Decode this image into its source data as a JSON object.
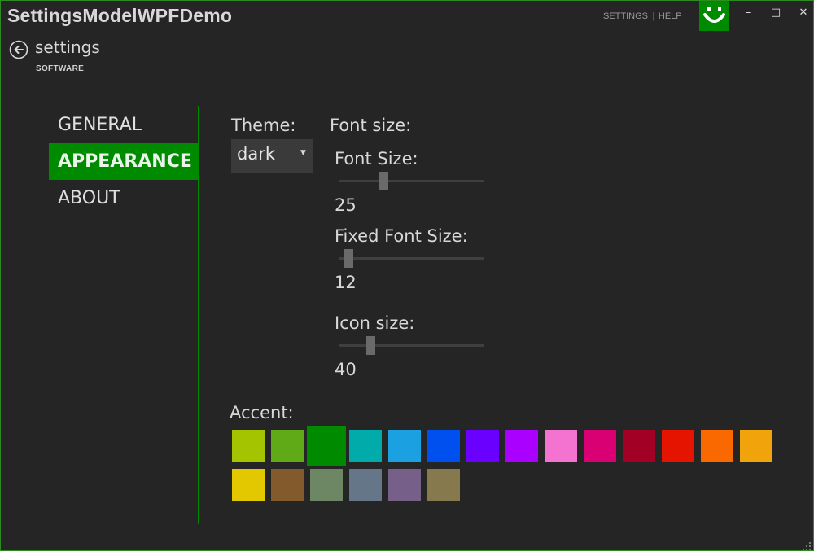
{
  "window": {
    "title": "SettingsModelWPFDemo",
    "links": {
      "settings": "SETTINGS",
      "separator": "|",
      "help": "HELP"
    },
    "buttons": {
      "minimize": "–",
      "maximize": "□",
      "close": "✕"
    },
    "logo_icon": "smiley-icon",
    "accent_color": "#008a00"
  },
  "header": {
    "back_icon": "back-arrow-icon",
    "title": "settings",
    "subtitle": "SOFTWARE"
  },
  "nav": {
    "items": [
      {
        "label": "GENERAL",
        "selected": false
      },
      {
        "label": "APPEARANCE",
        "selected": true
      },
      {
        "label": "ABOUT",
        "selected": false
      }
    ]
  },
  "appearance": {
    "theme": {
      "label": "Theme:",
      "value": "dark",
      "arrow_icon": "dropdown-arrow-icon"
    },
    "font_size_group": {
      "label": "Font size:"
    },
    "font_size": {
      "label": "Font Size:",
      "value": "25",
      "slider_fraction": 0.31
    },
    "fixed_font_size": {
      "label": "Fixed Font Size:",
      "value": "12",
      "slider_fraction": 0.07
    },
    "icon_size": {
      "label": "Icon size:",
      "value": "40",
      "slider_fraction": 0.22
    },
    "accent": {
      "label": "Accent:",
      "selected_index": 2,
      "colors": [
        "#a4c400",
        "#60a917",
        "#008a00",
        "#00aba9",
        "#1ba1e2",
        "#0050ef",
        "#6a00ff",
        "#aa00ff",
        "#f472d0",
        "#d80073",
        "#a20025",
        "#e51400",
        "#fa6800",
        "#f0a30a",
        "#e3c800",
        "#825a2c",
        "#6d8764",
        "#647687",
        "#76608a",
        "#87794e"
      ]
    }
  }
}
